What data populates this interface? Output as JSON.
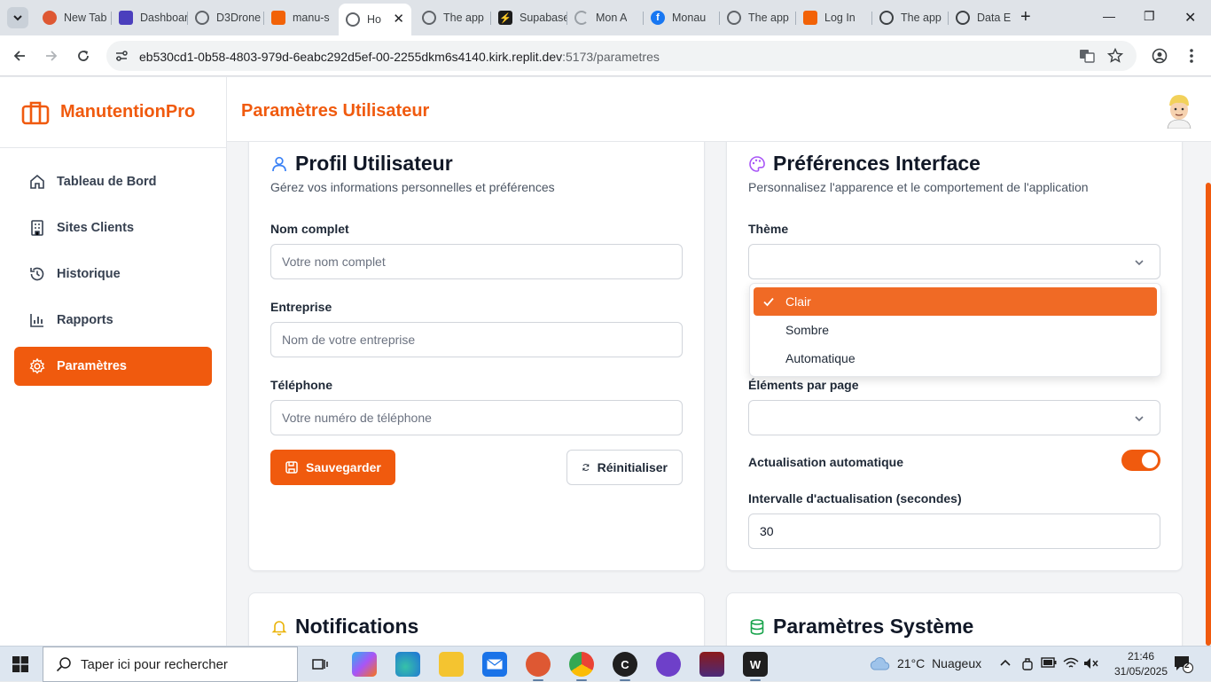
{
  "browser": {
    "tabs": [
      {
        "title": "New Tab",
        "icon": "duckduckgo-icon"
      },
      {
        "title": "Dashboard",
        "icon": "replit-dashboard-icon"
      },
      {
        "title": "D3Drone",
        "icon": "globe-icon"
      },
      {
        "title": "manu-s",
        "icon": "replit-icon"
      },
      {
        "title": "Ho",
        "icon": "globe-icon",
        "active": true
      },
      {
        "title": "The app",
        "icon": "globe-icon"
      },
      {
        "title": "Supabase",
        "icon": "supabase-icon"
      },
      {
        "title": "Mon A",
        "icon": "loading-icon"
      },
      {
        "title": "Monau",
        "icon": "facebook-icon"
      },
      {
        "title": "The app",
        "icon": "globe-icon"
      },
      {
        "title": "Log In",
        "icon": "replit-icon"
      },
      {
        "title": "The app",
        "icon": "chatgpt-icon"
      },
      {
        "title": "Data E",
        "icon": "chatgpt-icon"
      }
    ],
    "url_host": "eb530cd1-0b58-4803-979d-6eabc292d5ef-00-2255dkm6s4140.kirk.replit.dev",
    "url_path": ":5173/parametres"
  },
  "app": {
    "brand": "ManutentionPro",
    "page_title": "Paramètres Utilisateur",
    "nav": [
      {
        "label": "Tableau de Bord",
        "icon": "home-icon"
      },
      {
        "label": "Sites Clients",
        "icon": "building-icon"
      },
      {
        "label": "Historique",
        "icon": "history-icon"
      },
      {
        "label": "Rapports",
        "icon": "bar-chart-icon"
      },
      {
        "label": "Paramètres",
        "icon": "settings-icon",
        "active": true
      }
    ]
  },
  "profile": {
    "title": "Profil Utilisateur",
    "subtitle": "Gérez vos informations personnelles et préférences",
    "name_label": "Nom complet",
    "name_placeholder": "Votre nom complet",
    "company_label": "Entreprise",
    "company_placeholder": "Nom de votre entreprise",
    "phone_label": "Téléphone",
    "phone_placeholder": "Votre numéro de téléphone",
    "save_label": "Sauvegarder",
    "reset_label": "Réinitialiser"
  },
  "preferences": {
    "title": "Préférences Interface",
    "subtitle": "Personnalisez l'apparence et le comportement de l'application",
    "theme_label": "Thème",
    "theme_options": [
      "Clair",
      "Sombre",
      "Automatique"
    ],
    "theme_selected": "Clair",
    "items_label": "Éléments par page",
    "auto_refresh_label": "Actualisation automatique",
    "auto_refresh_on": true,
    "interval_label": "Intervalle d'actualisation (secondes)",
    "interval_value": "30"
  },
  "notifications": {
    "title": "Notifications"
  },
  "system": {
    "title": "Paramètres Système"
  },
  "taskbar": {
    "search_placeholder": "Taper ici pour rechercher",
    "temperature": "21°C",
    "weather": "Nuageux",
    "time": "21:46",
    "date": "31/05/2025",
    "notif_count": "2"
  },
  "colors": {
    "accent": "#f05a0e",
    "accent_light": "#f06a25"
  }
}
